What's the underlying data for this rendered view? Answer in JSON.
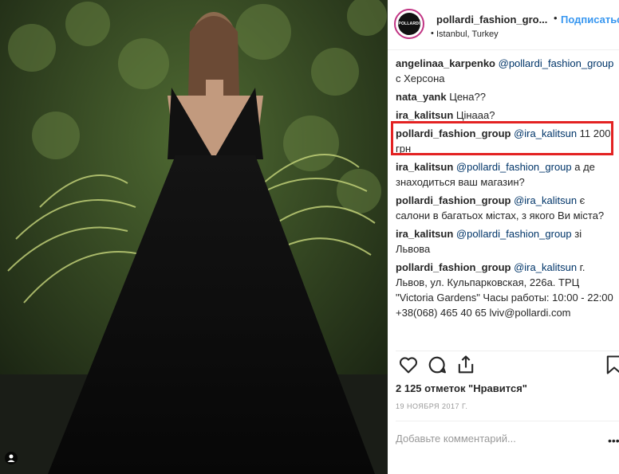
{
  "post": {
    "username": "pollardi_fashion_gro...",
    "separator": "•",
    "follow_label": "Подписаться",
    "location": "Istanbul, Turkey",
    "avatar_text": "POLLARDI"
  },
  "comments": [
    {
      "user": "angelinaa_karpenko",
      "mention": "@pollardi_fashion_group",
      "text": " с Херсона"
    },
    {
      "user": "nata_yank",
      "mention": "",
      "text": " Цена??"
    },
    {
      "user": "ira_kalitsun",
      "mention": "",
      "text": " Цінааа?"
    },
    {
      "user": "pollardi_fashion_group",
      "mention": "@ira_kalitsun",
      "text": " 11 200 грн"
    },
    {
      "user": "ira_kalitsun",
      "mention": "@pollardi_fashion_group",
      "text": " а де знаходиться ваш магазин?"
    },
    {
      "user": "pollardi_fashion_group",
      "mention": "@ira_kalitsun",
      "text": " є салони в багатьох містах, з якого Ви міста?"
    },
    {
      "user": "ira_kalitsun",
      "mention": "@pollardi_fashion_group",
      "text": " зі Львова"
    },
    {
      "user": "pollardi_fashion_group",
      "mention": "@ira_kalitsun",
      "text": " г. Львов, ул. Кульпарковская, 226а. ТРЦ \"Victoria Gardens\" Часы работы: 10:00 - 22:00 +38(068) 465 40 65 lviv@pollardi.com"
    }
  ],
  "likes": "2 125 отметок \"Нравится\"",
  "date": "19 НОЯБРЯ 2017 Г.",
  "comment_placeholder": "Добавьте комментарий...",
  "more_glyph": "•••",
  "icons": [
    "heart-icon",
    "comment-icon",
    "share-icon",
    "bookmark-icon",
    "user-tag-icon"
  ]
}
